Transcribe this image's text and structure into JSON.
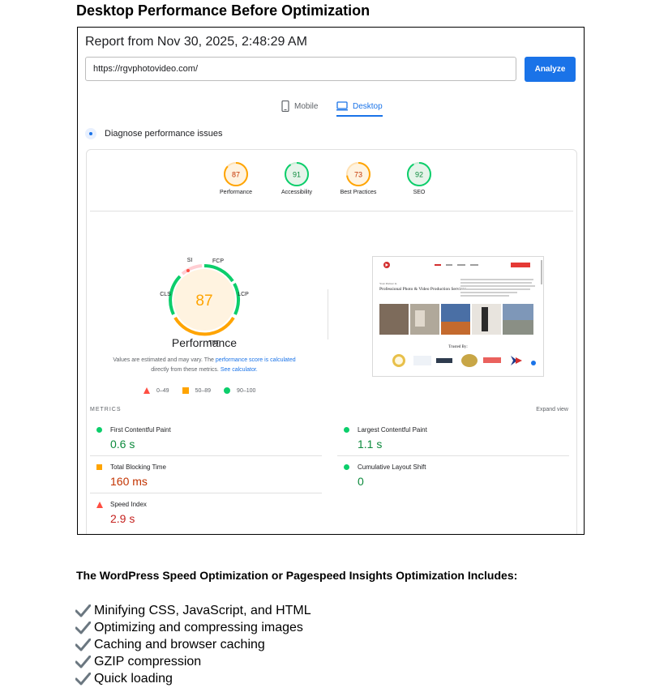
{
  "heading": "Desktop Performance Before Optimization",
  "report": {
    "title": "Report from Nov 30, 2025, 2:48:29 AM",
    "url": "https://rgvphotovideo.com/",
    "analyze_label": "Analyze"
  },
  "tabs": {
    "mobile": "Mobile",
    "desktop": "Desktop"
  },
  "diagnose_label": "Diagnose performance issues",
  "scores": [
    {
      "label": "Performance",
      "value": "87",
      "color": "#ffa400"
    },
    {
      "label": "Accessibility",
      "value": "91",
      "color": "#0cce6b"
    },
    {
      "label": "Best Practices",
      "value": "73",
      "color": "#ffa400"
    },
    {
      "label": "SEO",
      "value": "92",
      "color": "#0cce6b"
    }
  ],
  "big_gauge": {
    "score": "87",
    "label": "Performance",
    "segments": {
      "si": "SI",
      "fcp": "FCP",
      "lcp": "LCP",
      "tbt": "TBT",
      "cls": "CLS"
    }
  },
  "note": {
    "text1": "Values are estimated and may vary. The ",
    "link1": "performance score is calculated",
    "text2": " directly from these metrics. ",
    "link2": "See calculator."
  },
  "legend": {
    "poor": "0–49",
    "average": "50–89",
    "good": "90–100"
  },
  "metrics_title": "METRICS",
  "expand_view": "Expand view",
  "metrics": {
    "fcp": {
      "name": "First Contentful Paint",
      "value": "0.6 s"
    },
    "lcp": {
      "name": "Largest Contentful Paint",
      "value": "1.1 s"
    },
    "tbt": {
      "name": "Total Blocking Time",
      "value": "160 ms"
    },
    "cls": {
      "name": "Cumulative Layout Shift",
      "value": "0"
    },
    "si": {
      "name": "Speed Index",
      "value": "2.9 s"
    }
  },
  "screenshot": {
    "heading_small": "Your Partner in",
    "heading_main": "Professional Photo & Video Production Services",
    "trusted": "Trusted By:"
  },
  "includes_heading": "The WordPress Speed Optimization or Pagespeed Insights Optimization Includes:",
  "includes": [
    "Minifying CSS, JavaScript, and HTML",
    "Optimizing and compressing images",
    "Caching and browser caching",
    "GZIP compression",
    "Quick loading"
  ],
  "colors": {
    "accent": "#1a73e8",
    "pass": "#0cce6b",
    "average": "#ffa400",
    "fail": "#ff4e42"
  }
}
